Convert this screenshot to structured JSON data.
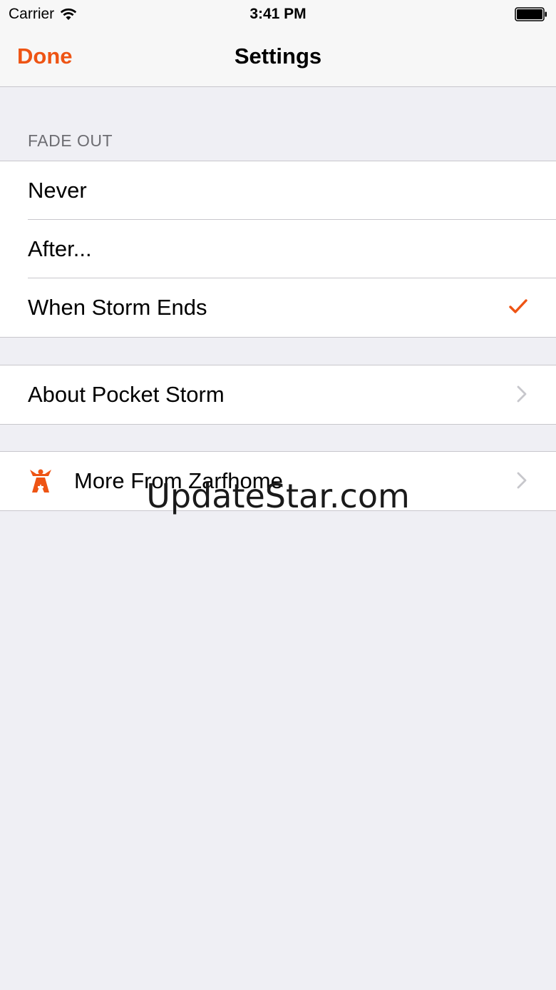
{
  "status_bar": {
    "carrier": "Carrier",
    "time": "3:41 PM",
    "icons": [
      "wifi-icon",
      "battery-icon"
    ]
  },
  "nav": {
    "done_label": "Done",
    "title": "Settings"
  },
  "fade_out": {
    "header": "FADE OUT",
    "options": [
      {
        "label": "Never",
        "selected": false
      },
      {
        "label": "After...",
        "selected": false
      },
      {
        "label": "When Storm Ends",
        "selected": true
      }
    ]
  },
  "about": {
    "label": "About Pocket Storm"
  },
  "more": {
    "label": "More From Zarfhome",
    "icon": "zarfhome-icon"
  },
  "watermark": "UpdateStar.com",
  "colors": {
    "accent": "#ee5414",
    "background": "#efeff4",
    "separator": "#c8c7cc",
    "section_header": "#6d6d72"
  }
}
